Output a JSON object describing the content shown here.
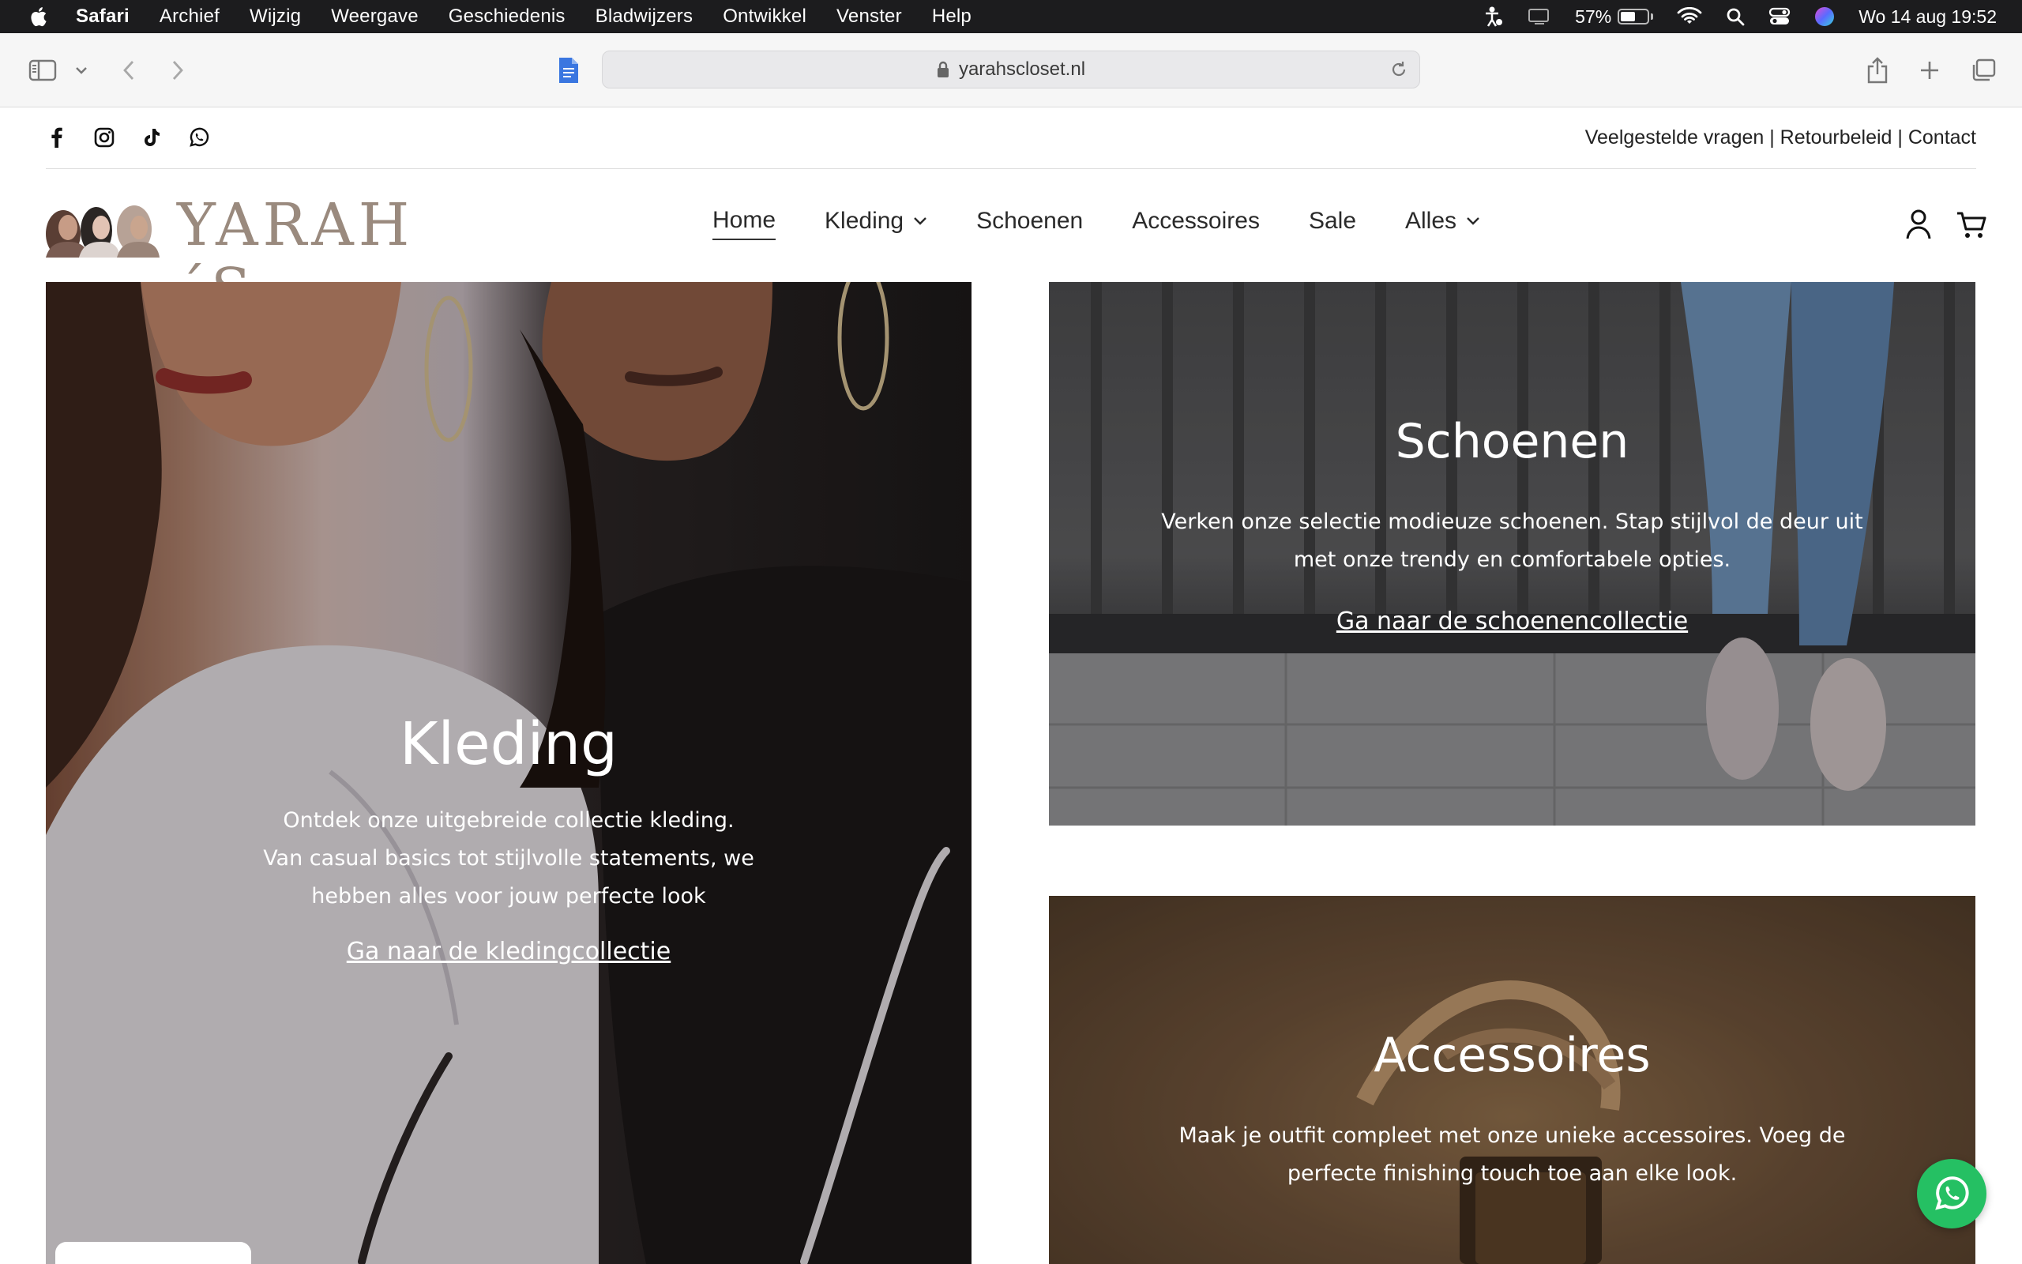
{
  "menubar": {
    "app": "Safari",
    "items": [
      "Archief",
      "Wijzig",
      "Weergave",
      "Geschiedenis",
      "Bladwijzers",
      "Ontwikkel",
      "Venster",
      "Help"
    ],
    "battery": "57%",
    "battery_level": 0.57,
    "datetime": "Wo 14 aug  19:52"
  },
  "browser": {
    "url": "yarahscloset.nl"
  },
  "site": {
    "social_icons": [
      "facebook-icon",
      "instagram-icon",
      "tiktok-icon",
      "whatsapp-icon"
    ],
    "toplinks": "Veelgestelde vragen | Retourbeleid | Contact",
    "logo_text": "YARAH´S",
    "nav": {
      "home": "Home",
      "kleding": "Kleding",
      "schoenen": "Schoenen",
      "accessoires": "Accessoires",
      "sale": "Sale",
      "alles": "Alles"
    }
  },
  "tiles": {
    "kleding": {
      "title": "Kleding",
      "line1": "Ontdek onze uitgebreide collectie kleding.",
      "line2": "Van casual basics tot stijlvolle statements, we",
      "line3": "hebben alles voor jouw perfecte look",
      "link": "Ga naar de kledingcollectie"
    },
    "schoenen": {
      "title": "Schoenen",
      "line1": "Verken onze selectie modieuze schoenen. Stap stijlvol de deur uit",
      "line2": "met onze trendy en comfortabele opties.",
      "link": "Ga naar de schoenencollectie"
    },
    "accessoires": {
      "title": "Accessoires",
      "line1": "Maak je outfit compleet met onze unieke accessoires. Voeg de",
      "line2": "perfecte finishing touch toe aan elke look."
    }
  },
  "colors": {
    "whatsapp_green": "#25c063",
    "menubar": "#1c1c1e",
    "logo": "#9a8a7e"
  }
}
